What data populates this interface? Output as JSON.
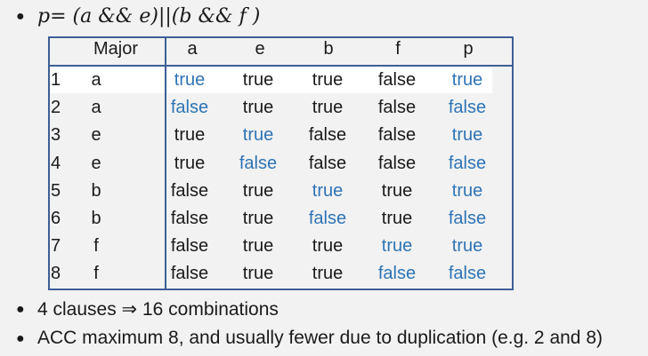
{
  "formula": "p= (a && e)||(b && f )",
  "table": {
    "headers": [
      "",
      "Major",
      "a",
      "e",
      "b",
      "f",
      "p"
    ],
    "rows": [
      {
        "num": "1",
        "major": "a",
        "values": [
          "true",
          "true",
          "true",
          "false",
          "true"
        ],
        "highlight": [
          true,
          false,
          false,
          false,
          true
        ]
      },
      {
        "num": "2",
        "major": "a",
        "values": [
          "false",
          "true",
          "true",
          "false",
          "false"
        ],
        "highlight": [
          true,
          false,
          false,
          false,
          true
        ]
      },
      {
        "num": "3",
        "major": "e",
        "values": [
          "true",
          "true",
          "false",
          "false",
          "true"
        ],
        "highlight": [
          false,
          true,
          false,
          false,
          true
        ]
      },
      {
        "num": "4",
        "major": "e",
        "values": [
          "true",
          "false",
          "false",
          "false",
          "false"
        ],
        "highlight": [
          false,
          true,
          false,
          false,
          true
        ]
      },
      {
        "num": "5",
        "major": "b",
        "values": [
          "false",
          "true",
          "true",
          "true",
          "true"
        ],
        "highlight": [
          false,
          false,
          true,
          false,
          true
        ]
      },
      {
        "num": "6",
        "major": "b",
        "values": [
          "false",
          "true",
          "false",
          "true",
          "false"
        ],
        "highlight": [
          false,
          false,
          true,
          false,
          true
        ]
      },
      {
        "num": "7",
        "major": "f",
        "values": [
          "false",
          "true",
          "true",
          "true",
          "true"
        ],
        "highlight": [
          false,
          false,
          false,
          true,
          true
        ]
      },
      {
        "num": "8",
        "major": "f",
        "values": [
          "false",
          "true",
          "true",
          "false",
          "false"
        ],
        "highlight": [
          false,
          false,
          false,
          true,
          true
        ]
      }
    ]
  },
  "bullets": [
    "4 clauses ⇒ 16 combinations",
    "ACC maximum 8, and usually fewer due to duplication (e.g. 2 and 8)"
  ],
  "colors": {
    "highlight_text": "#2e74b5",
    "table_border": "#3d5f96",
    "background": "#f2f2f2"
  }
}
